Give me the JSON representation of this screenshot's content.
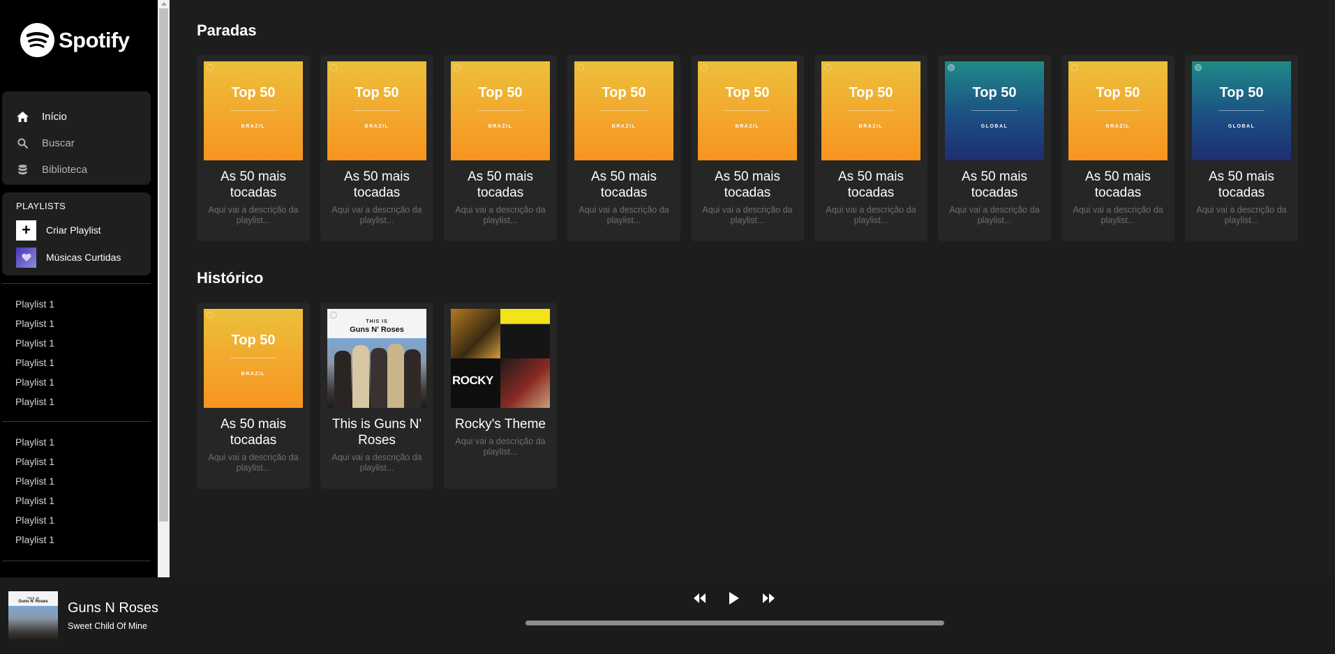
{
  "brand": {
    "name": "Spotify"
  },
  "nav": [
    {
      "label": "Início",
      "icon": "home-icon",
      "active": true
    },
    {
      "label": "Buscar",
      "icon": "search-icon",
      "active": false
    },
    {
      "label": "Biblioteca",
      "icon": "library-icon",
      "active": false
    }
  ],
  "playlists_box": {
    "heading": "PLAYLISTS",
    "create": "Criar Playlist",
    "liked": "Músicas Curtidas"
  },
  "playlist_group_1": [
    "Playlist 1",
    "Playlist 1",
    "Playlist 1",
    "Playlist 1",
    "Playlist 1",
    "Playlist 1"
  ],
  "playlist_group_2": [
    "Playlist 1",
    "Playlist 1",
    "Playlist 1",
    "Playlist 1",
    "Playlist 1",
    "Playlist 1"
  ],
  "sections": {
    "charts_title": "Paradas",
    "history_title": "Histórico"
  },
  "charts": [
    {
      "cover": "brazil",
      "cover_title": "Top 50",
      "cover_sub": "BRAZIL",
      "title": "As 50 mais tocadas",
      "desc": "Aqui vai a descrição da playlist..."
    },
    {
      "cover": "brazil",
      "cover_title": "Top 50",
      "cover_sub": "BRAZIL",
      "title": "As 50 mais tocadas",
      "desc": "Aqui vai a descrição da playlist..."
    },
    {
      "cover": "brazil",
      "cover_title": "Top 50",
      "cover_sub": "BRAZIL",
      "title": "As 50 mais tocadas",
      "desc": "Aqui vai a descrição da playlist..."
    },
    {
      "cover": "brazil",
      "cover_title": "Top 50",
      "cover_sub": "BRAZIL",
      "title": "As 50 mais tocadas",
      "desc": "Aqui vai a descrição da playlist..."
    },
    {
      "cover": "brazil",
      "cover_title": "Top 50",
      "cover_sub": "BRAZIL",
      "title": "As 50 mais tocadas",
      "desc": "Aqui vai a descrição da playlist..."
    },
    {
      "cover": "brazil",
      "cover_title": "Top 50",
      "cover_sub": "BRAZIL",
      "title": "As 50 mais tocadas",
      "desc": "Aqui vai a descrição da playlist..."
    },
    {
      "cover": "global",
      "cover_title": "Top 50",
      "cover_sub": "GLOBAL",
      "title": "As 50 mais tocadas",
      "desc": "Aqui vai a descrição da playlist..."
    },
    {
      "cover": "brazil",
      "cover_title": "Top 50",
      "cover_sub": "BRAZIL",
      "title": "As 50 mais tocadas",
      "desc": "Aqui vai a descrição da playlist..."
    },
    {
      "cover": "global",
      "cover_title": "Top 50",
      "cover_sub": "GLOBAL",
      "title": "As 50 mais tocadas",
      "desc": "Aqui vai a descrição da playlist..."
    }
  ],
  "history": [
    {
      "cover": "brazil",
      "cover_title": "Top 50",
      "cover_sub": "BRAZIL",
      "title": "As 50 mais tocadas",
      "desc": "Aqui vai a descrição da playlist..."
    },
    {
      "cover": "guns",
      "cover_top": "THIS IS",
      "cover_title": "Guns N' Roses",
      "title": "This is Guns N' Roses",
      "desc": "Aqui vai a descrição da playlist..."
    },
    {
      "cover": "rocky",
      "cover_title": "ROCKY",
      "title": "Rocky's Theme",
      "desc": "Aqui vai a descrição da playlist..."
    }
  ],
  "player": {
    "cover_top": "THIS IS",
    "cover_title": "Guns N' Roses",
    "artist": "Guns N Roses",
    "track": "Sweet Child Of Mine",
    "controls": [
      "rewind-icon",
      "play-icon",
      "fast-forward-icon"
    ],
    "progress": 0
  },
  "colors": {
    "background": "#000000",
    "main": "#1d1d1d",
    "card": "#262626",
    "panel": "#1f1f1f",
    "accent": "#ffffff"
  }
}
